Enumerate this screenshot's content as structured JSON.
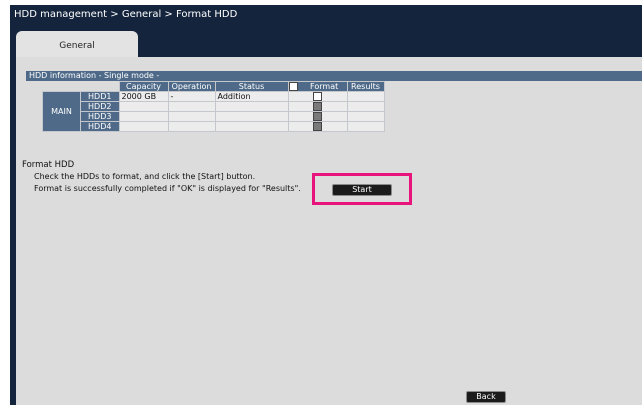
{
  "breadcrumb": "HDD management > General > Format HDD",
  "tabs": [
    {
      "label": "General"
    }
  ],
  "section_title": "HDD information - Single mode -",
  "table": {
    "headers": [
      "Capacity",
      "Operation",
      "Status",
      "Format",
      "Results"
    ],
    "group_label": "MAIN",
    "rows": [
      {
        "label": "HDD1",
        "capacity": "2000 GB",
        "operation": "-",
        "status": "Addition",
        "results": ""
      },
      {
        "label": "HDD2",
        "capacity": "",
        "operation": "",
        "status": "",
        "results": ""
      },
      {
        "label": "HDD3",
        "capacity": "",
        "operation": "",
        "status": "",
        "results": ""
      },
      {
        "label": "HDD4",
        "capacity": "",
        "operation": "",
        "status": "",
        "results": ""
      }
    ]
  },
  "format": {
    "title": "Format HDD",
    "line1": "Check the HDDs to format, and click the [Start] button.",
    "line2": "Format is successfully completed if \"OK\" is displayed for \"Results\".",
    "start_label": "Start"
  },
  "back_label": "Back",
  "colors": {
    "frame": "#14243c",
    "header": "#4e6a88",
    "content": "#dcdcdc",
    "highlight": "#e8137b"
  }
}
